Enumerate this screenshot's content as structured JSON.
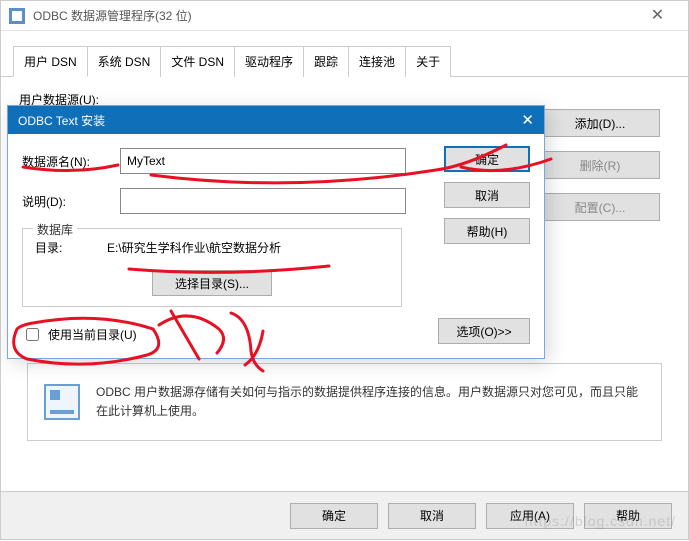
{
  "window": {
    "title": "ODBC 数据源管理程序(32 位)",
    "close_glyph": "✕"
  },
  "tabs": [
    "用户 DSN",
    "系统 DSN",
    "文件 DSN",
    "驱动程序",
    "跟踪",
    "连接池",
    "关于"
  ],
  "panel": {
    "user_ds_label": "用户数据源(U):"
  },
  "side_buttons": {
    "add": "添加(D)...",
    "remove": "删除(R)",
    "configure": "配置(C)..."
  },
  "info_text": "ODBC 用户数据源存储有关如何与指示的数据提供程序连接的信息。用户数据源只对您可见，而且只能在此计算机上使用。",
  "bottom": {
    "ok": "确定",
    "cancel": "取消",
    "apply": "应用(A)",
    "help": "帮助"
  },
  "dialog": {
    "title": "ODBC Text 安装",
    "close_glyph": "✕",
    "dsn_label": "数据源名(N):",
    "dsn_value": "MyText",
    "desc_label": "说明(D):",
    "desc_value": "",
    "ok": "确定",
    "cancel": "取消",
    "help": "帮助(H)",
    "group_legend": "数据库",
    "dir_label": "目录:",
    "dir_value": "E:\\研究生学科作业\\航空数据分析",
    "choose_dir": "选择目录(S)...",
    "use_current_dir": "使用当前目录(U)",
    "options": "选项(O)>>"
  },
  "watermark": "https://blog.csdn.net/"
}
